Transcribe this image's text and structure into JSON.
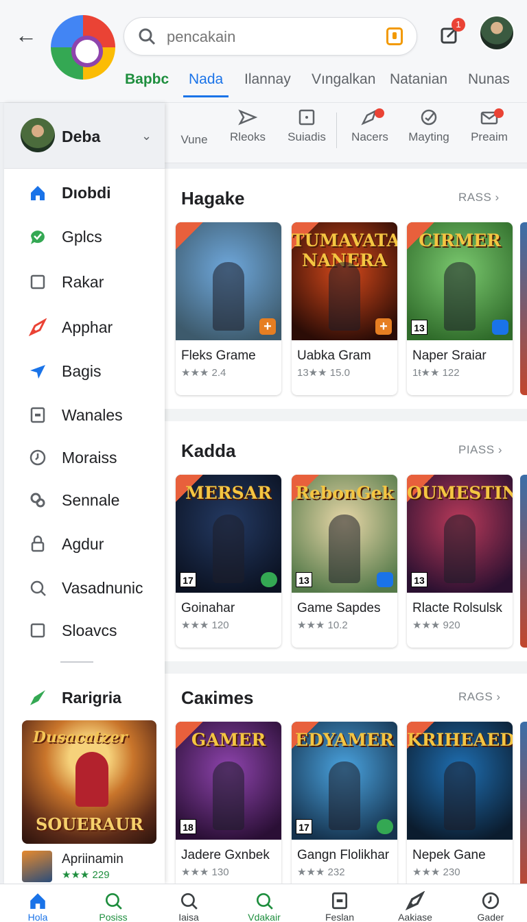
{
  "header": {
    "search_placeholder": "pencakain",
    "notification_count": "1",
    "brand_tab": "Bapbc",
    "tabs": [
      "Nada",
      "Ilannay",
      "Vıngalkan",
      "Natanian",
      "Nunas"
    ],
    "active_tab_index": 0
  },
  "subbar": {
    "items": [
      {
        "label": "Vune",
        "icon": "none"
      },
      {
        "label": "Rleoks",
        "icon": "send-icon"
      },
      {
        "label": "Suiadis",
        "icon": "square-icon"
      },
      {
        "label": "Nacers",
        "icon": "rocket-icon",
        "badge": true
      },
      {
        "label": "Mayting",
        "icon": "check-circle-icon"
      },
      {
        "label": "Preaim",
        "icon": "mail-icon",
        "badge": true
      }
    ]
  },
  "sidebar": {
    "user_name": "Deba",
    "items": [
      {
        "label": "Dıobdi",
        "icon": "home-icon",
        "color": "#1a73e8",
        "bold": true
      },
      {
        "label": "Gplcs",
        "icon": "chat-icon",
        "color": "#34a853"
      },
      {
        "label": "Rakar",
        "icon": "square-icon",
        "color": "#5f6368"
      },
      {
        "label": "Apphar",
        "icon": "rocket-icon",
        "color": "#ea4335"
      },
      {
        "label": "Bagis",
        "icon": "send-icon",
        "color": "#1a73e8"
      },
      {
        "label": "Wanales",
        "icon": "wallet-icon",
        "color": "#5f6368"
      },
      {
        "label": "Moraiss",
        "icon": "clock-icon",
        "color": "#5f6368"
      },
      {
        "label": "Sennale",
        "icon": "gear-icon",
        "color": "#5f6368"
      },
      {
        "label": "Agdur",
        "icon": "lock-icon",
        "color": "#5f6368"
      },
      {
        "label": "Vasadnunic",
        "icon": "search-icon",
        "color": "#5f6368"
      },
      {
        "label": "Sloavcs",
        "icon": "square-icon",
        "color": "#5f6368"
      }
    ],
    "section_label": "Rarigria",
    "feature_title": "Dusacatzer",
    "feature_subtitle": "SOUERAUR",
    "mini_app": {
      "title": "Apriinamin",
      "rating": "★★★ 229"
    }
  },
  "sections": [
    {
      "title": "Hagake",
      "more": "RASS",
      "cards": [
        {
          "title": "Fleks Grame",
          "rating": "★★★ 2.4",
          "art_title": "",
          "colors": [
            "#6fa8dc",
            "#3d5a6c"
          ],
          "badge": "plus"
        },
        {
          "title": "Uabka Gram",
          "rating": "13★★ 15.0",
          "art_title": "TUMAVATA NANERA",
          "colors": [
            "#d84a1b",
            "#2b0c06"
          ],
          "badge": "plus"
        },
        {
          "title": "Naper Sraiar",
          "rating": "1ŧ★★ 122",
          "art_title": "CIRMER",
          "colors": [
            "#7bc96f",
            "#2f6b2a"
          ],
          "badge": "blue",
          "age": "13"
        }
      ]
    },
    {
      "title": "Kadda",
      "more": "PIASS",
      "cards": [
        {
          "title": "Goinahar",
          "rating": "★★★ 120",
          "art_title": "MERSAR",
          "colors": [
            "#243a63",
            "#0b1222"
          ],
          "badge": "green",
          "age": "17"
        },
        {
          "title": "Game Sapdes",
          "rating": "★★★ 10.2",
          "art_title": "RebonGek",
          "colors": [
            "#e8d7a8",
            "#557a4a"
          ],
          "badge": "blue",
          "age": "13"
        },
        {
          "title": "Rlacte Rolsulsk",
          "rating": "★★★ 920",
          "art_title": "OUMESTIN",
          "colors": [
            "#b93a5a",
            "#2a1030"
          ],
          "badge": "none",
          "age": "13"
        }
      ]
    },
    {
      "title": "Caкimes",
      "more": "RAGS",
      "cards": [
        {
          "title": "Jadere Gxnbek",
          "rating": "★★★ 130",
          "art_title": "GAMER",
          "colors": [
            "#8e44ad",
            "#2a0f35"
          ],
          "badge": "none",
          "age": "18"
        },
        {
          "title": "Gangn Flolikhar",
          "rating": "★★★ 232",
          "art_title": "EDYAMER",
          "colors": [
            "#4aa3df",
            "#15324d"
          ],
          "badge": "green",
          "age": "17"
        },
        {
          "title": "Nepek Gane",
          "rating": "★★★ 230",
          "art_title": "KRIHEAED",
          "colors": [
            "#1f6fb2",
            "#0b1c2e"
          ],
          "badge": "none"
        }
      ]
    }
  ],
  "bottom_nav": {
    "items": [
      {
        "label": "Hola",
        "icon": "home-icon",
        "state": "active"
      },
      {
        "label": "Posiss",
        "icon": "search-icon",
        "state": "green"
      },
      {
        "label": "Iaisa",
        "icon": "search-icon",
        "state": ""
      },
      {
        "label": "Vdakair",
        "icon": "search-icon",
        "state": "green"
      },
      {
        "label": "Feslan",
        "icon": "wallet-icon",
        "state": ""
      },
      {
        "label": "Aakiase",
        "icon": "rocket-icon",
        "state": ""
      },
      {
        "label": "Gader",
        "icon": "clock-icon",
        "state": ""
      }
    ]
  }
}
